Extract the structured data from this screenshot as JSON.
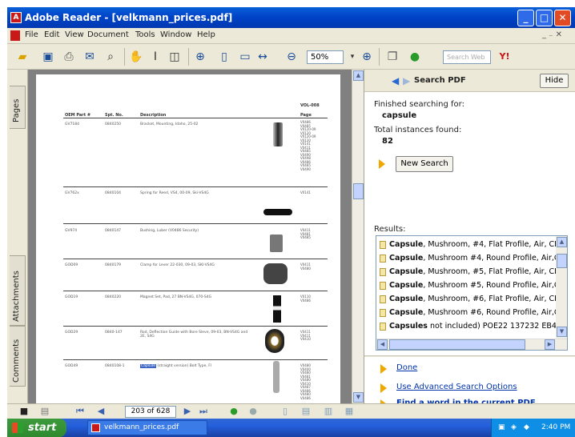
{
  "window": {
    "title": "Adobe Reader - [velkmann_prices.pdf]",
    "app_icon": "A"
  },
  "window_controls": {
    "minimize": "_",
    "maximize": "□",
    "close": "✕"
  },
  "menu": {
    "items": [
      "File",
      "Edit",
      "View",
      "Document",
      "Tools",
      "Window",
      "Help"
    ],
    "controls": "_ ₋ ✕"
  },
  "toolbar": {
    "zoom_value": "50%",
    "search_web_placeholder": "Search Web"
  },
  "side_tabs": {
    "pages": "Pages",
    "attachments": "Attachments",
    "comments": "Comments"
  },
  "document": {
    "header_code": "VOL-008",
    "columns": [
      "OEM Part #",
      "Spt. No.",
      "Description",
      "Page"
    ],
    "rows": [
      {
        "oem": "GV7184",
        "spt": "0840250",
        "desc": "Bracket, Mounting, Idaho, 25-02",
        "pages": "V0486\nV0485\nV0120-09\nV0120\nV0120-09\nV0120\nV0141\nV0411\nV0485\nV0490\nV0498\nV0486\nV0485\nV0490"
      },
      {
        "oem": "GV762x",
        "spt": "0840104",
        "desc": "Spring for Reed, VS4, 00-09, Ski-VS4G",
        "pages": "V0141"
      },
      {
        "oem": "GV974",
        "spt": "0840147",
        "desc": "Bushing, Luber (V0486 Security)",
        "pages": "V0411\nV0481\nV0485"
      },
      {
        "oem": "GOD09",
        "spt": "0840179",
        "desc": "Clamp for Lever 22-030, 09-03, SKI-VS4G",
        "pages": "V0411\nV0480"
      },
      {
        "oem": "GOD19",
        "spt": "0840220",
        "desc": "Magnet Set, Pad, 27 BN-VS4G, 070-S4G",
        "pages": "V0110\nV0486"
      },
      {
        "oem": "GOD29",
        "spt": "0840-147",
        "desc": "Rod, Deflection Guide with Bore Sleve, 09-03, BN-VS4G and 2E, S4G",
        "pages": "V0411\nV0411\nV0410"
      },
      {
        "oem": "GOD49",
        "spt": "0840108-1",
        "desc_highlight": "Capsule",
        "desc": "(straight version) Bolt Type, Fl",
        "pages": "V0480\nV0400\nV0480\nV0481\nV0480\nV0410\nV0487\nV0486\nV0480\nV0486"
      }
    ]
  },
  "search_panel": {
    "title": "Search PDF",
    "hide_label": "Hide",
    "finished_label": "Finished searching for:",
    "query": "capsule",
    "total_label": "Total instances found:",
    "total_count": "82",
    "new_search_label": "New Search",
    "results_label": "Results:",
    "results": [
      {
        "bold": "Capsule",
        "rest": ", Mushroom, #4, Flat Profile, Air, CH"
      },
      {
        "bold": "Capsule",
        "rest": ", Mushroom #4, Round Profile, Air,C"
      },
      {
        "bold": "Capsule",
        "rest": ", Mushroom, #5, Flat Profile, Air, CH"
      },
      {
        "bold": "Capsule",
        "rest": ", Mushroom #5, Round Profile, Air,C"
      },
      {
        "bold": "Capsule",
        "rest": ", Mushroom, #6, Flat Profile, Air, CH"
      },
      {
        "bold": "Capsule",
        "rest": ", Mushroom #6, Round Profile, Air,C"
      },
      {
        "bold": "Capsules",
        "rest": " not included) POE22 137232 EB40"
      }
    ],
    "links": {
      "done": "Done",
      "advanced": "Use Advanced Search Options",
      "find_word": "Find a word in the current PDF document"
    }
  },
  "statusbar": {
    "page_indicator": "203 of 628"
  },
  "taskbar": {
    "start_label": "start",
    "task_label": "velkmann_prices.pdf",
    "clock": "2:40 PM"
  }
}
